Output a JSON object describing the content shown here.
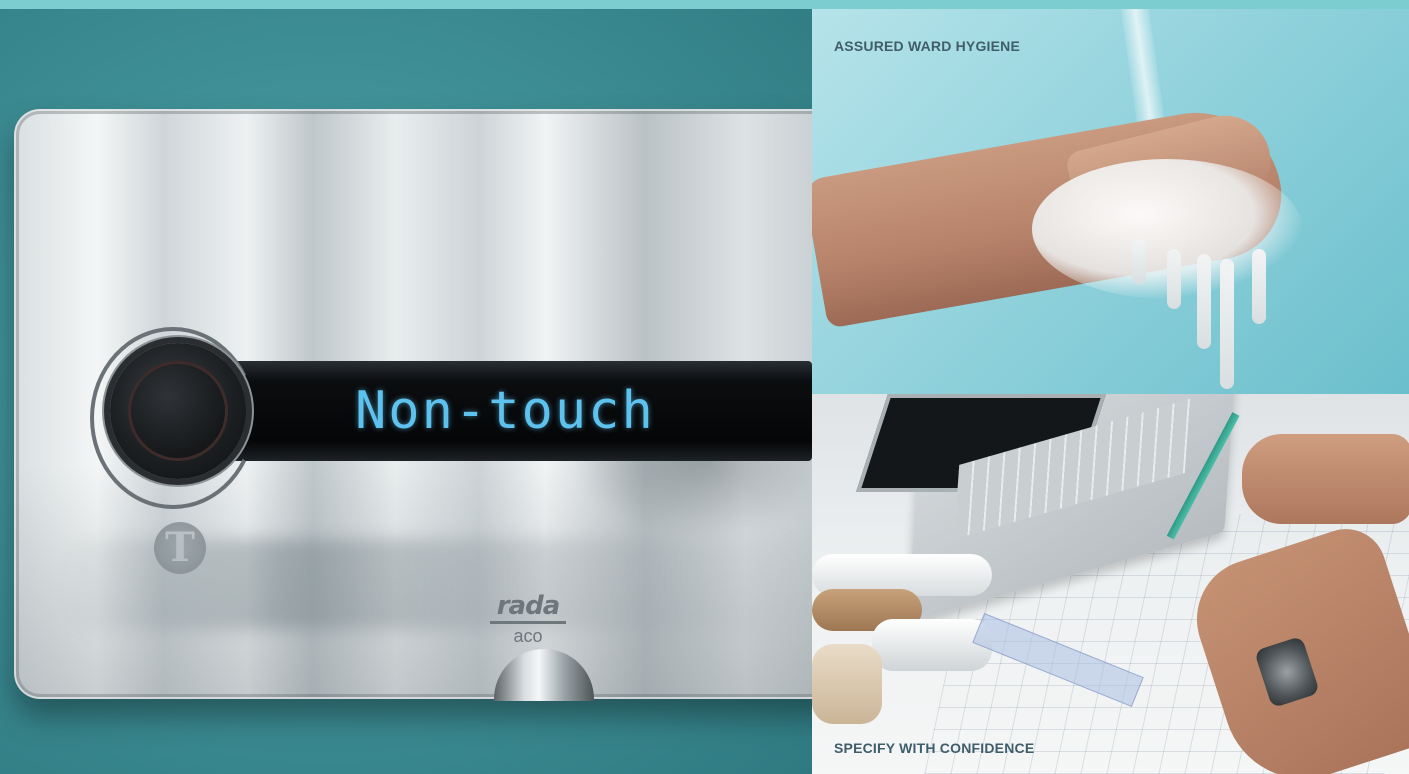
{
  "colors": {
    "background": "#3e8f96",
    "top_band": "#7ccdd0",
    "display_text": "#5ec2ee",
    "caption_text": "#3f5e6a"
  },
  "hero": {
    "display_text": "Non-touch",
    "brand_name": "rada",
    "brand_sub": "aco"
  },
  "panels": {
    "hygiene_caption": "ASSURED WARD HYGIENE",
    "specify_caption": "SPECIFY WITH CONFIDENCE"
  },
  "icons": [
    "sensor-button-icon",
    "t-logo-icon"
  ]
}
